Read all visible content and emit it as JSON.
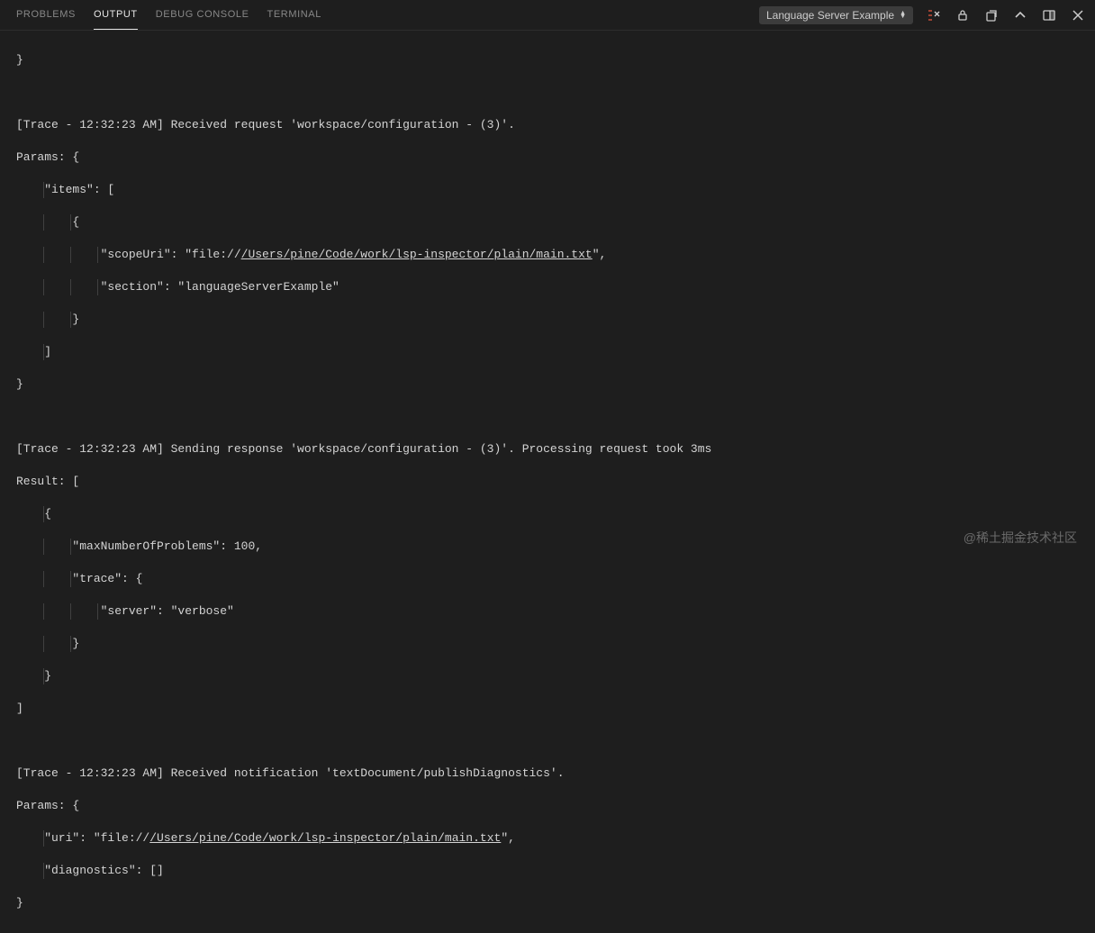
{
  "tabs": {
    "problems": "PROBLEMS",
    "output": "OUTPUT",
    "debugConsole": "DEBUG CONSOLE",
    "terminal": "TERMINAL"
  },
  "dropdown": {
    "selected": "Language Server Example"
  },
  "output": {
    "line01": "}",
    "line02": "",
    "line03": "",
    "line04": "[Trace - 12:32:23 AM] Received request 'workspace/configuration - (3)'.",
    "line05": "Params: {",
    "line06": "    \"items\": [",
    "line07": "        {",
    "line08a": "            \"scopeUri\": \"file://",
    "line08b": "/Users/pine/Code/work/lsp-inspector/plain/main.txt",
    "line08c": "\",",
    "line09": "            \"section\": \"languageServerExample\"",
    "line10": "        }",
    "line11": "    ]",
    "line12": "}",
    "line13": "",
    "line14": "",
    "line15": "[Trace - 12:32:23 AM] Sending response 'workspace/configuration - (3)'. Processing request took 3ms",
    "line16": "Result: [",
    "line17": "    {",
    "line18": "        \"maxNumberOfProblems\": 100,",
    "line19": "        \"trace\": {",
    "line20": "            \"server\": \"verbose\"",
    "line21": "        }",
    "line22": "    }",
    "line23": "]",
    "line24": "",
    "line25": "",
    "line26": "[Trace - 12:32:23 AM] Received notification 'textDocument/publishDiagnostics'.",
    "line27": "Params: {",
    "line28a": "    \"uri\": \"file://",
    "line28b": "/Users/pine/Code/work/lsp-inspector/plain/main.txt",
    "line28c": "\",",
    "line29": "    \"diagnostics\": []",
    "line30": "}"
  },
  "watermark": "@稀土掘金技术社区"
}
